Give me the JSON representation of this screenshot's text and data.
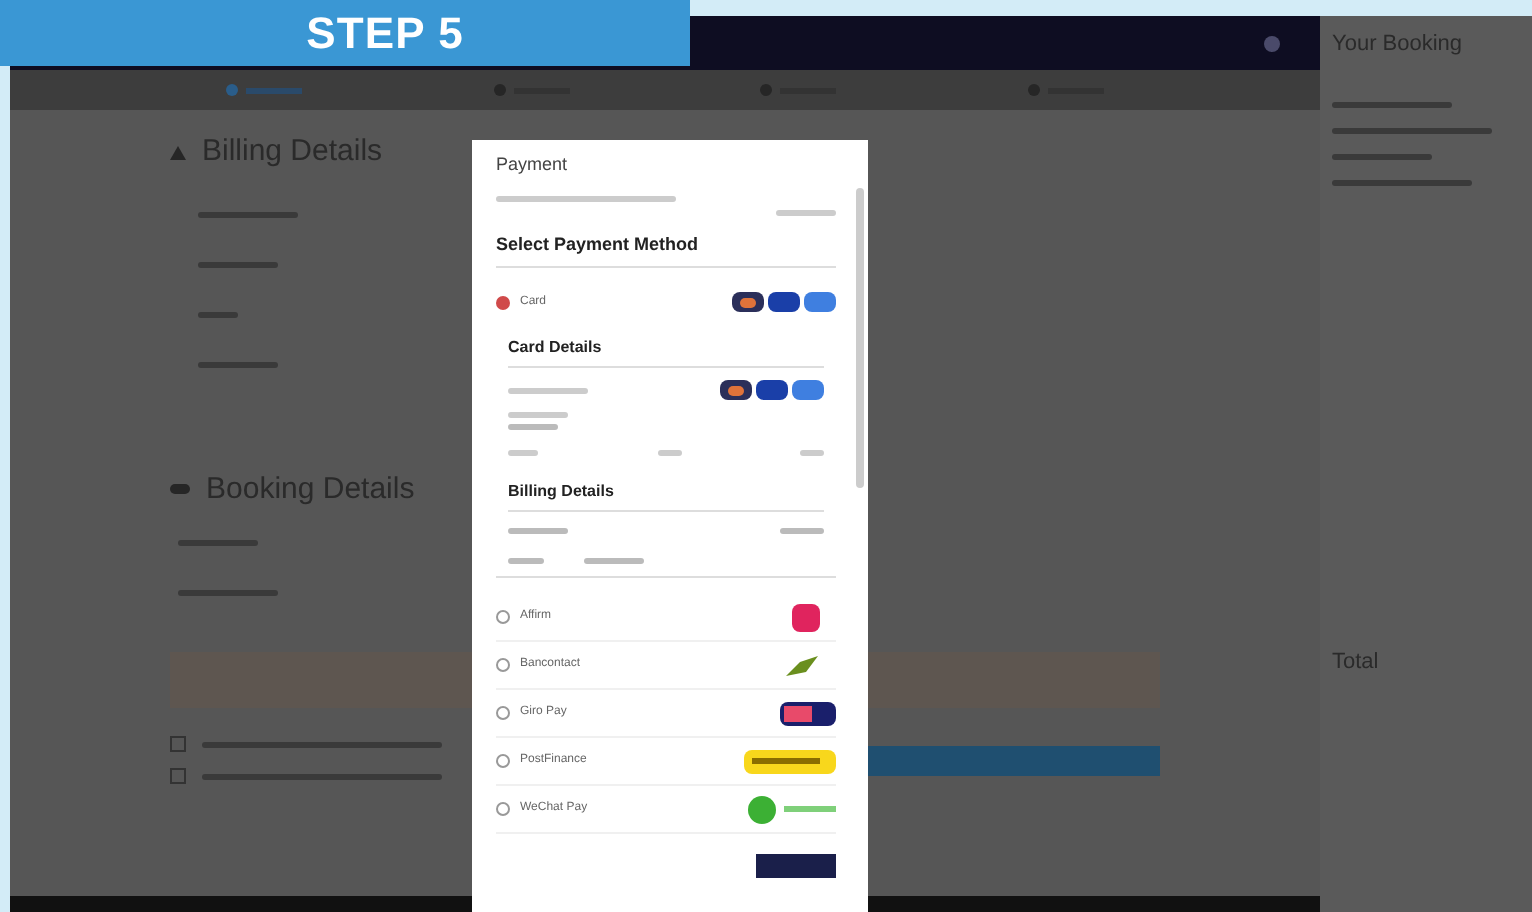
{
  "banner": {
    "title": "STEP 5"
  },
  "steps": [
    {
      "selected": true
    },
    {
      "selected": false
    },
    {
      "selected": false
    },
    {
      "selected": false
    }
  ],
  "billing": {
    "title": "Billing Details"
  },
  "booking": {
    "title": "Booking Details"
  },
  "agreements": [
    {
      "checked": false
    },
    {
      "checked": false
    }
  ],
  "sidebar": {
    "title": "Your Booking",
    "total_label": "Total"
  },
  "modal": {
    "title": "Payment",
    "section_title": "Select Payment Method",
    "card_details_title": "Card Details",
    "billing_title": "Billing Details",
    "methods": [
      {
        "label": "Card",
        "selected": true,
        "kind": "cards"
      },
      {
        "label": "Affirm",
        "selected": false,
        "kind": "affirm"
      },
      {
        "label": "Bancontact",
        "selected": false,
        "kind": "bancontact"
      },
      {
        "label": "Giro Pay",
        "selected": false,
        "kind": "giropay"
      },
      {
        "label": "PostFinance",
        "selected": false,
        "kind": "postfinance"
      },
      {
        "label": "WeChat Pay",
        "selected": false,
        "kind": "wechat"
      }
    ]
  }
}
